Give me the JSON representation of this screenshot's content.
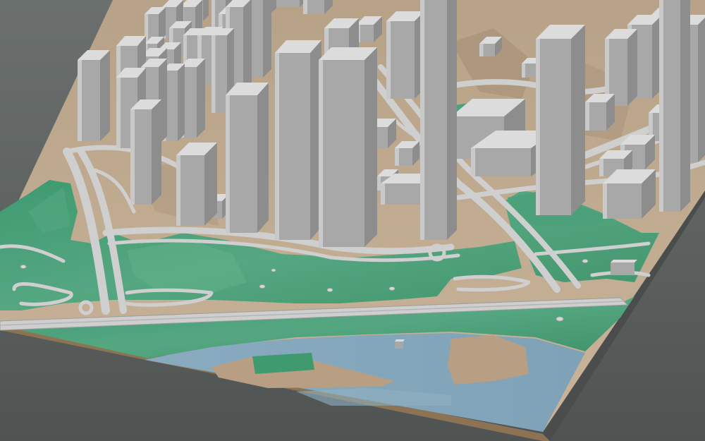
{
  "scene": {
    "palette": {
      "background": "#5d6261",
      "ground": "#c2ad93",
      "base_edge": "#8a7356",
      "park": "#4a9c76",
      "water": "#86a9bd",
      "sand": "#b89f83",
      "road": "#cfcfcf",
      "road_edge": "#9e9e9e",
      "building_light": "#c9c9c9",
      "building_front": "#a8a8a8",
      "building_side": "#8d8d8d",
      "building_roof": "#dcdcdc"
    },
    "layers": [
      "terrain",
      "water",
      "parks",
      "roads",
      "buildings"
    ]
  }
}
